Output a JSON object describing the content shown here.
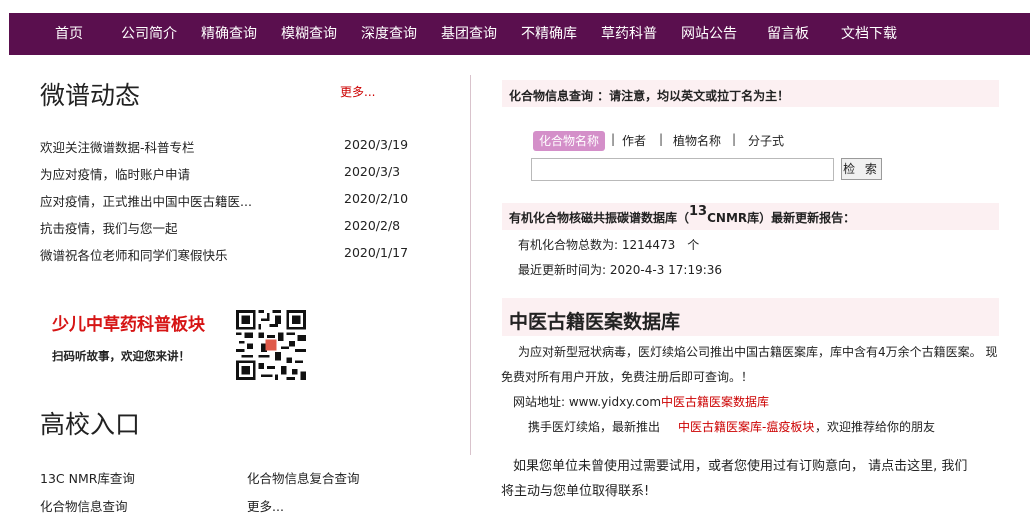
{
  "nav": {
    "items": [
      "首页",
      "公司简介",
      "精确查询",
      "模糊查询",
      "深度查询",
      "基团查询",
      "不精确库",
      "草药科普",
      "网站公告",
      "留言板",
      "文档下载"
    ]
  },
  "news": {
    "heading": "微谱动态",
    "more": "更多...",
    "items": [
      {
        "title": "欢迎关注微谱数据-科普专栏",
        "date": "2020/3/19"
      },
      {
        "title": "为应对疫情，临时账户申请",
        "date": "2020/3/3"
      },
      {
        "title": "应对疫情，正式推出中国中医古籍医...",
        "date": "2020/2/10"
      },
      {
        "title": "抗击疫情，我们与您一起",
        "date": "2020/2/8"
      },
      {
        "title": "微谱祝各位老师和同学们寒假快乐",
        "date": "2020/1/17"
      }
    ]
  },
  "promo": {
    "title": "少儿中草药科普板块",
    "subtitle": "扫码听故事，欢迎您来讲！"
  },
  "university": {
    "heading": "高校入口",
    "links": [
      "13C NMR库查询",
      "化合物信息复合查询",
      "化合物信息查询",
      "更多..."
    ]
  },
  "compound_query": {
    "title": "化合物信息查询 ：请注意，均以英文或拉丁名为主！",
    "tabs": [
      "化合物名称",
      "作者",
      "植物名称",
      "分子式"
    ],
    "input_value": "",
    "search_button": "检 索"
  },
  "nmr_report": {
    "title_pre": "有机化合物核磁共振碳谱数据库（",
    "title_sup": "13",
    "title_post": "CNMR库）最新更新报告：",
    "total": "有机化合物总数为: 1214473　个",
    "updated": "最近更新时间为: 2020-4-3 17:19:36"
  },
  "tcm": {
    "title": "中医古籍医案数据库",
    "para": "为应对新型冠状病毒，医灯续焰公司推出中国古籍医案库，库中含有4万余个古籍医案。 现",
    "para2": "免费对所有用户开放，免费注册后即可查询。！",
    "site_label": "网站地址: www.yidxy.com",
    "site_link": "中医古籍医案数据库",
    "promo_pre": "携手医灯续焰，最新推出",
    "promo_link": "中医古籍医案库-瘟疫板块",
    "promo_post": "，欢迎推荐给你的朋友"
  },
  "contact": {
    "line1": "如果您单位未曾使用过需要试用，或者您使用过有订购意向， 请点击这里, 我们",
    "line2": "将主动与您单位取得联系!"
  },
  "colors": {
    "nav_bg": "#5a0f4e",
    "accent_red": "#cc0000",
    "tab_active": "#d48fc9",
    "band_bg": "#fcf0f2"
  }
}
